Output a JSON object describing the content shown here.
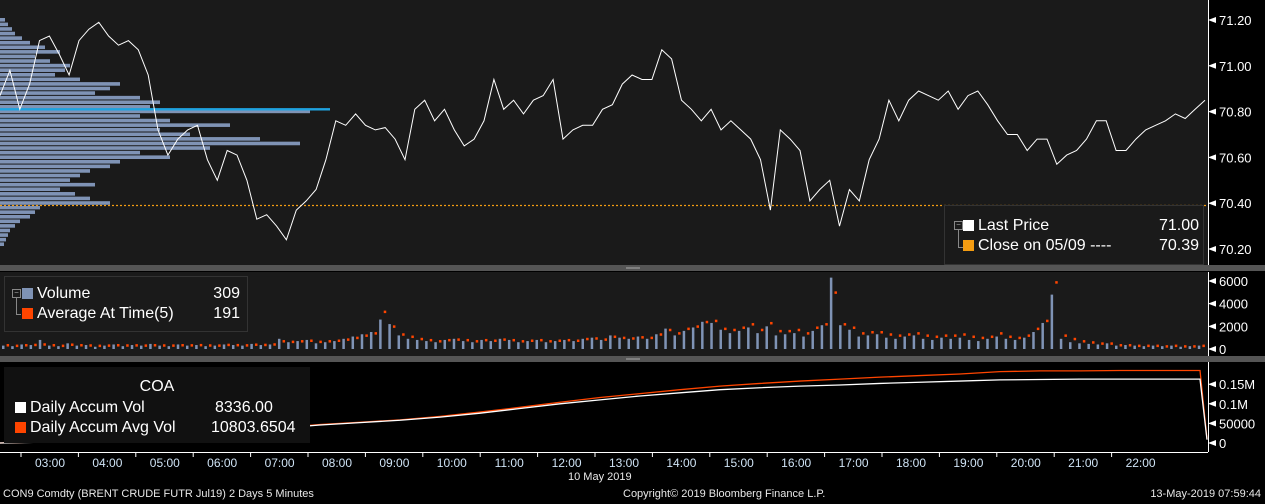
{
  "colors": {
    "price": "#ffffff",
    "close": "#f39c12",
    "volume": "#7f93b5",
    "avg": "#ff4500",
    "accum": "#ffffff",
    "accum_avg": "#ff4500",
    "highlight": "#1fa3e0",
    "profile": "#7f93b5"
  },
  "price_legend": {
    "last_label": "Last Price",
    "last_value": "71.00",
    "close_label": "Close on 05/09 ----",
    "close_value": "70.39"
  },
  "volume_legend": {
    "vol_label": "Volume",
    "vol_value": "309",
    "avg_label": "Average At Time(5)",
    "avg_value": "191"
  },
  "accum_legend": {
    "title": "COA",
    "vol_label": "Daily Accum Vol",
    "vol_value": "8336.00",
    "avg_label": "Daily Accum Avg Vol",
    "avg_value": "10803.6504"
  },
  "footer": {
    "left": "CON9 Comdty (BRENT CRUDE FUTR  Jul19) 2 Days 5 Minutes",
    "center": "Copyright© 2019 Bloomberg Finance L.P.",
    "right": "13-May-2019 07:59:44",
    "date": "10 May 2019"
  },
  "chart_data": [
    {
      "type": "line",
      "title": "Last Price",
      "ylim": [
        70.15,
        71.25
      ],
      "yticks": [
        "71.20",
        "71.00",
        "70.80",
        "70.60",
        "70.40",
        "70.20"
      ],
      "x_range_hours": [
        2.13,
        23.09
      ],
      "close_value": 70.39,
      "values": [
        70.87,
        70.98,
        70.81,
        70.92,
        71.11,
        71.13,
        71.05,
        70.96,
        71.11,
        71.16,
        71.19,
        71.13,
        71.09,
        71.11,
        71.07,
        70.96,
        70.72,
        70.61,
        70.68,
        70.72,
        70.74,
        70.59,
        70.5,
        70.63,
        70.61,
        70.5,
        70.33,
        70.35,
        70.3,
        70.24,
        70.37,
        70.41,
        70.46,
        70.59,
        70.76,
        70.74,
        70.79,
        70.74,
        70.72,
        70.73,
        70.68,
        70.59,
        70.81,
        70.85,
        70.76,
        70.81,
        70.72,
        70.65,
        70.68,
        70.76,
        70.94,
        70.81,
        70.85,
        70.79,
        70.85,
        70.87,
        70.94,
        70.68,
        70.72,
        70.74,
        70.74,
        70.81,
        70.83,
        70.92,
        70.96,
        70.94,
        70.94,
        71.07,
        71.03,
        70.85,
        70.81,
        70.76,
        70.81,
        70.72,
        70.76,
        70.72,
        70.68,
        70.59,
        70.37,
        70.72,
        70.68,
        70.63,
        70.41,
        70.46,
        70.5,
        70.3,
        70.46,
        70.41,
        70.59,
        70.68,
        70.85,
        70.76,
        70.85,
        70.89,
        70.87,
        70.85,
        70.89,
        70.81,
        70.87,
        70.89,
        70.83,
        70.76,
        70.7,
        70.7,
        70.63,
        70.68,
        70.68,
        70.57,
        70.61,
        70.63,
        70.68,
        70.76,
        70.76,
        70.63,
        70.63,
        70.68,
        70.72,
        70.74,
        70.76,
        70.79,
        70.77,
        70.81,
        70.85
      ]
    },
    {
      "type": "bar",
      "title": "Volume Profile",
      "prices": [
        71.2,
        71.18,
        71.16,
        71.14,
        71.12,
        71.1,
        71.08,
        71.06,
        71.04,
        71.02,
        71.0,
        70.98,
        70.96,
        70.94,
        70.92,
        70.9,
        70.88,
        70.86,
        70.84,
        70.82,
        70.8,
        70.78,
        70.76,
        70.74,
        70.72,
        70.7,
        70.68,
        70.66,
        70.64,
        70.62,
        70.6,
        70.58,
        70.56,
        70.54,
        70.52,
        70.5,
        70.48,
        70.46,
        70.44,
        70.42,
        70.4,
        70.38,
        70.36,
        70.34,
        70.32,
        70.3,
        70.28,
        70.26,
        70.24,
        70.22
      ],
      "volumes": [
        5,
        8,
        12,
        15,
        22,
        30,
        45,
        60,
        35,
        50,
        70,
        65,
        55,
        80,
        120,
        110,
        95,
        140,
        160,
        150,
        310,
        140,
        170,
        230,
        160,
        190,
        260,
        300,
        210,
        140,
        170,
        120,
        110,
        90,
        80,
        70,
        95,
        60,
        75,
        90,
        110,
        40,
        35,
        30,
        20,
        15,
        10,
        8,
        6,
        4
      ],
      "highlight_price": 70.81
    },
    {
      "type": "bar",
      "title": "Volume",
      "ylim": [
        -400,
        6600
      ],
      "yticks": [
        "6000",
        "4000",
        "2000",
        "0"
      ],
      "volumes": [
        300,
        250,
        400,
        350,
        800,
        300,
        250,
        500,
        300,
        350,
        200,
        300,
        400,
        250,
        350,
        300,
        450,
        300,
        250,
        400,
        300,
        350,
        250,
        300,
        400,
        350,
        300,
        450,
        350,
        400,
        900,
        600,
        700,
        800,
        500,
        600,
        700,
        900,
        1100,
        1300,
        1500,
        2600,
        2200,
        1200,
        900,
        800,
        700,
        600,
        800,
        900,
        700,
        600,
        800,
        700,
        900,
        800,
        600,
        700,
        800,
        600,
        700,
        800,
        700,
        900,
        1000,
        800,
        1200,
        1000,
        900,
        1100,
        900,
        1300,
        1800,
        1200,
        1600,
        1900,
        2400,
        2300,
        1700,
        1400,
        1600,
        1900,
        1400,
        2000,
        1200,
        1300,
        1400,
        1100,
        1600,
        2100,
        6300,
        2100,
        1700,
        1100,
        1200,
        1300,
        1000,
        900,
        1100,
        1200,
        900,
        800,
        1000,
        900,
        1000,
        800,
        700,
        900,
        1100,
        900,
        800,
        1000,
        1500,
        2300,
        4800,
        900,
        600,
        500,
        450,
        400,
        500,
        300,
        350,
        300,
        250,
        300,
        250,
        300,
        200,
        250,
        300
      ],
      "averages": [
        350,
        300,
        350,
        380,
        420,
        350,
        300,
        400,
        350,
        330,
        300,
        320,
        350,
        330,
        340,
        320,
        350,
        330,
        320,
        350,
        340,
        360,
        330,
        320,
        380,
        360,
        340,
        400,
        380,
        420,
        700,
        650,
        700,
        750,
        650,
        700,
        750,
        850,
        1000,
        1200,
        1400,
        3300,
        2000,
        1300,
        1100,
        900,
        800,
        700,
        800,
        850,
        800,
        700,
        800,
        750,
        850,
        800,
        700,
        750,
        800,
        700,
        750,
        800,
        750,
        900,
        950,
        850,
        1100,
        1000,
        950,
        1050,
        1000,
        1300,
        1700,
        1400,
        1800,
        2000,
        2400,
        2500,
        1800,
        1700,
        1900,
        2200,
        1700,
        2300,
        1600,
        1600,
        1700,
        1400,
        1900,
        2200,
        5000,
        2200,
        1900,
        1400,
        1500,
        1500,
        1300,
        1200,
        1300,
        1400,
        1200,
        1100,
        1200,
        1200,
        1300,
        1100,
        1000,
        1100,
        1400,
        1100,
        1000,
        1200,
        1800,
        2500,
        5900,
        1200,
        900,
        700,
        600,
        500,
        500,
        350,
        350,
        300,
        300,
        300,
        250,
        300,
        250,
        250,
        300
      ]
    },
    {
      "type": "line",
      "title": "COA",
      "ylim": [
        -10000,
        200000
      ],
      "yticks": [
        "0.15M",
        "0.1M",
        "50000",
        "0"
      ],
      "accum": [
        0,
        2000,
        5000,
        9000,
        15000,
        22000,
        30000,
        38000,
        46000,
        52000,
        58000,
        66000,
        76000,
        88000,
        100000,
        110000,
        120000,
        128000,
        136000,
        141000,
        145000,
        148000,
        152000,
        155000,
        158000,
        161000,
        162000,
        163000,
        163000,
        163000,
        163000,
        8336
      ],
      "accum_avg": [
        0,
        2500,
        5500,
        10000,
        16000,
        23000,
        31000,
        39000,
        47000,
        53000,
        59000,
        68000,
        79000,
        91000,
        104000,
        116000,
        126000,
        136000,
        145000,
        152000,
        158000,
        163000,
        168000,
        172000,
        176000,
        182000,
        184000,
        184000,
        185000,
        185000,
        185000,
        10803.65
      ]
    },
    {
      "type": "axis",
      "x_ticks": [
        "03:00",
        "04:00",
        "05:00",
        "06:00",
        "07:00",
        "08:00",
        "09:00",
        "10:00",
        "11:00",
        "12:00",
        "13:00",
        "14:00",
        "15:00",
        "16:00",
        "17:00",
        "18:00",
        "19:00",
        "20:00",
        "21:00",
        "22:00"
      ]
    }
  ]
}
